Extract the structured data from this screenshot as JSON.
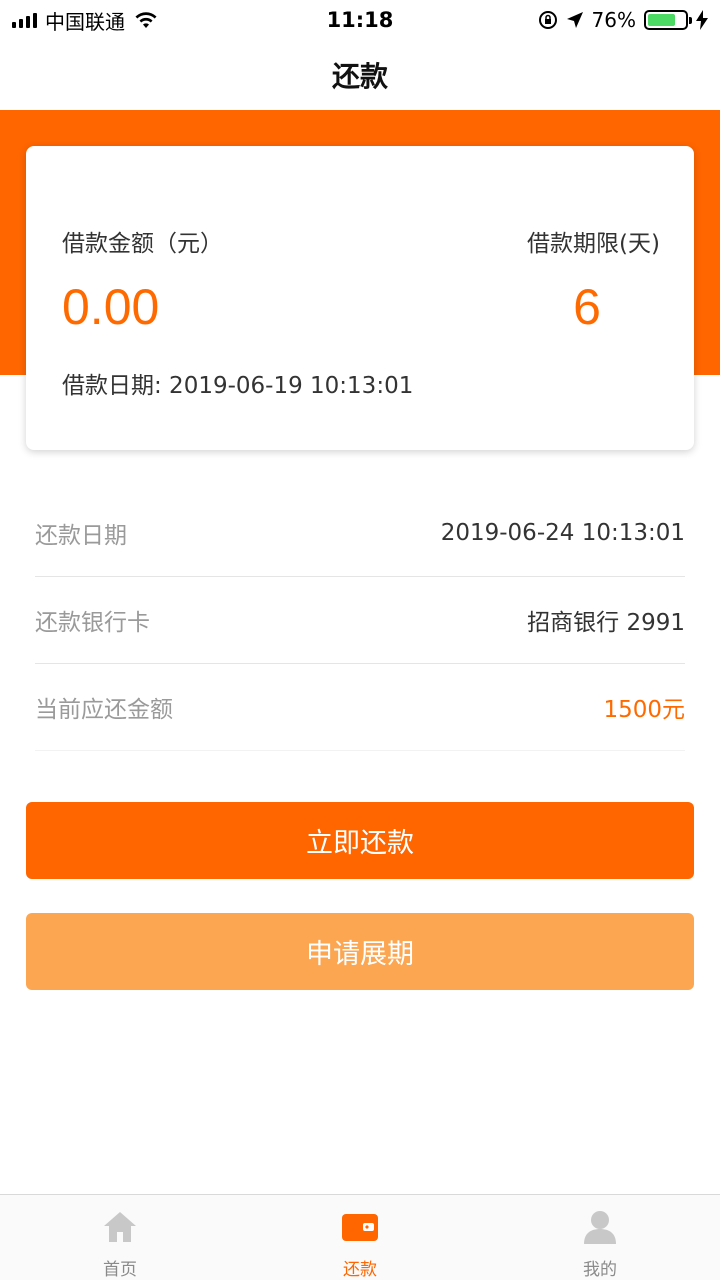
{
  "status_bar": {
    "carrier": "中国联通",
    "time": "11:18",
    "battery": "76%",
    "battery_level": 0.76
  },
  "nav": {
    "title": "还款"
  },
  "summary": {
    "amount_label": "借款金额（元）",
    "amount_value": "0.00",
    "term_label": "借款期限(天)",
    "term_value": "6",
    "date_text": "借款日期: 2019-06-19 10:13:01"
  },
  "details": [
    {
      "label": "还款日期",
      "value": "2019-06-24 10:13:01"
    },
    {
      "label": "还款银行卡",
      "value": "招商银行 2991"
    },
    {
      "label": "当前应还金额",
      "value": "1500元"
    }
  ],
  "buttons": {
    "repay": "立即还款",
    "extend": "申请展期"
  },
  "tabs": [
    {
      "label": "首页",
      "icon": "home-icon"
    },
    {
      "label": "还款",
      "icon": "wallet-icon"
    },
    {
      "label": "我的",
      "icon": "user-icon"
    }
  ],
  "colors": {
    "accent": "#ff6600",
    "secondary_button": "#fca651",
    "inactive_tab": "#c8c8c8"
  }
}
